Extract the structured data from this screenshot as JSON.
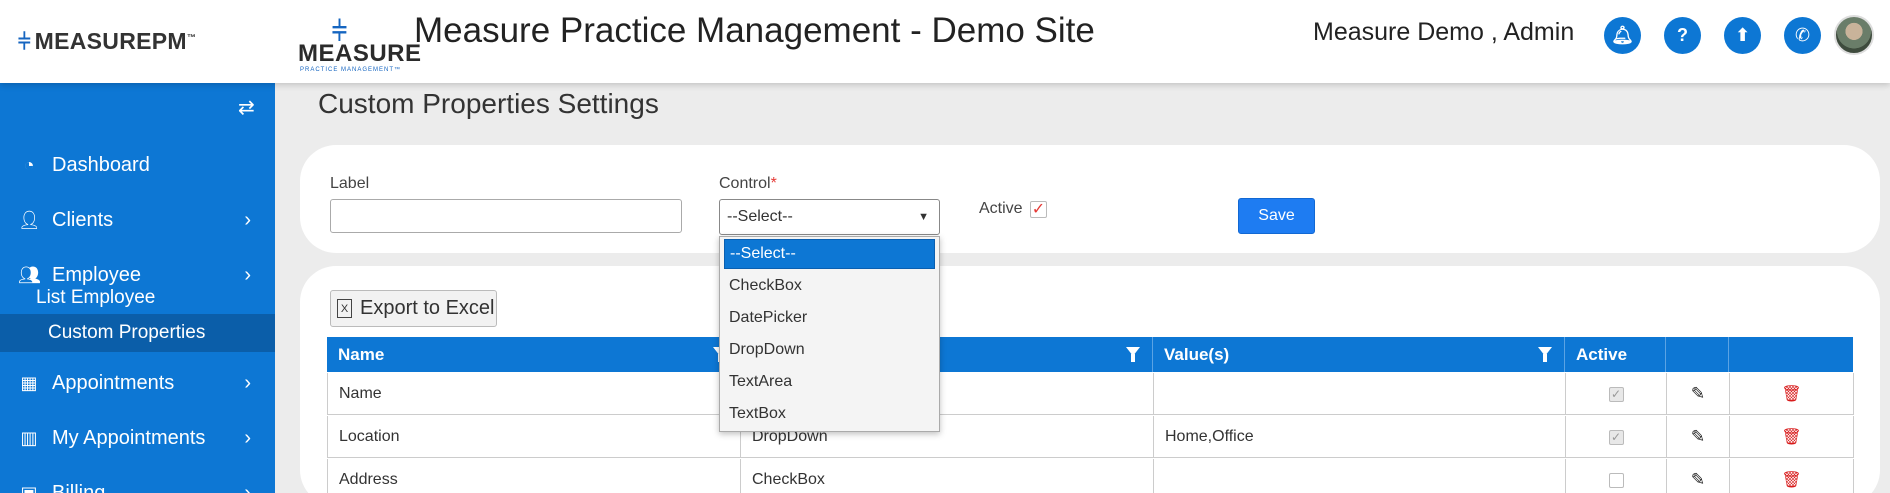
{
  "header": {
    "brand": "MEASUREPM",
    "brand_tm": "™",
    "logo_word": "MEASURE",
    "logo_sub": "PRACTICE MANAGEMENT™",
    "site_title": "Measure Practice Management - Demo Site",
    "user": "Measure Demo , Admin",
    "icons": [
      "bell-icon",
      "help-icon",
      "upload-icon",
      "phone-icon"
    ]
  },
  "sidebar": {
    "items": [
      {
        "label": "Dashboard",
        "icon": "dashboard-icon"
      },
      {
        "label": "Clients",
        "icon": "user-icon"
      },
      {
        "label": "Employee",
        "icon": "users-icon"
      },
      {
        "label": "Appointments",
        "icon": "calendar-icon"
      },
      {
        "label": "My Appointments",
        "icon": "building-icon"
      },
      {
        "label": "Billing",
        "icon": "billing-icon"
      }
    ],
    "sub_items": [
      {
        "label": "List Employee"
      },
      {
        "label": "Custom Properties",
        "active": true
      }
    ]
  },
  "page": {
    "title": "Custom Properties Settings",
    "form": {
      "label_label": "Label",
      "label_value": "",
      "control_label": "Control",
      "required_mark": "*",
      "control_value": "--Select--",
      "active_label": "Active",
      "active_checked": true,
      "save_label": "Save"
    },
    "dropdown_options": [
      "--Select--",
      "CheckBox",
      "DatePicker",
      "DropDown",
      "TextArea",
      "TextBox"
    ],
    "export_label": "Export to Excel",
    "table": {
      "headers": [
        "Name",
        "",
        "Value(s)",
        "Active",
        "",
        ""
      ],
      "rows": [
        {
          "name": "Name",
          "control": "",
          "values": "",
          "active": true
        },
        {
          "name": "Location",
          "control": "DropDown",
          "values": "Home,Office",
          "active": true
        },
        {
          "name": "Address",
          "control": "CheckBox",
          "values": "",
          "active": false
        }
      ]
    }
  }
}
